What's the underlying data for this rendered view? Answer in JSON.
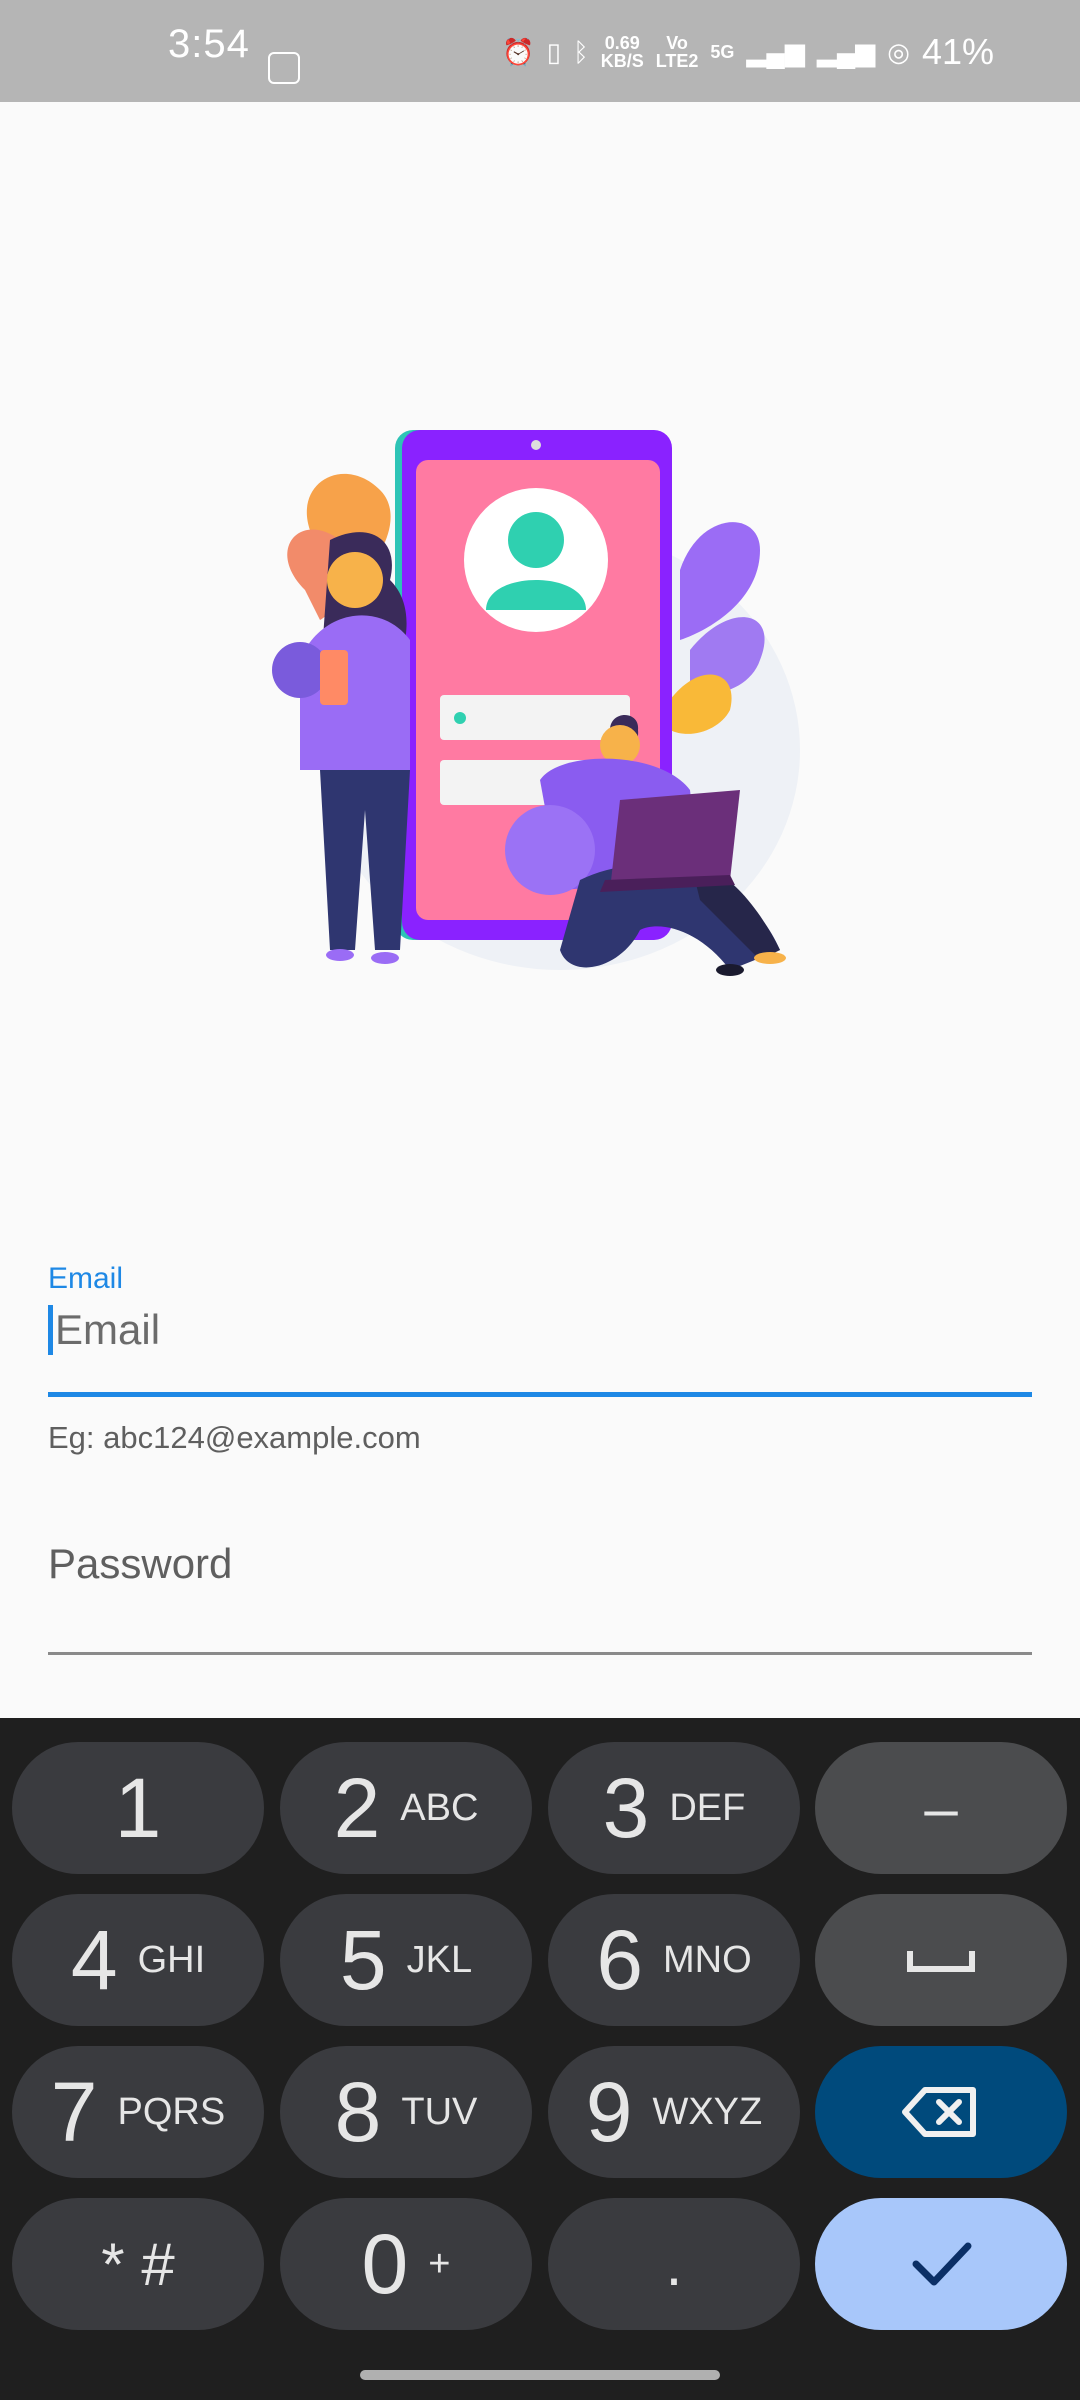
{
  "status_bar": {
    "time": "3:54",
    "net_speed_value": "0.69",
    "net_speed_unit": "KB/S",
    "volte_top": "Vo",
    "volte_bottom": "LTE2",
    "network": "5G",
    "battery": "41%"
  },
  "form": {
    "email_label": "Email",
    "email_placeholder": "Email",
    "email_helper": "Eg: abc124@example.com",
    "password_placeholder": "Password"
  },
  "keyboard": {
    "keys": [
      {
        "num": "1",
        "letters": ""
      },
      {
        "num": "2",
        "letters": "ABC"
      },
      {
        "num": "3",
        "letters": "DEF"
      },
      {
        "num": "4",
        "letters": "GHI"
      },
      {
        "num": "5",
        "letters": "JKL"
      },
      {
        "num": "6",
        "letters": "MNO"
      },
      {
        "num": "7",
        "letters": "PQRS"
      },
      {
        "num": "8",
        "letters": "TUV"
      },
      {
        "num": "9",
        "letters": "WXYZ"
      },
      {
        "num": "* #",
        "letters": ""
      },
      {
        "num": "0",
        "letters": "+"
      },
      {
        "num": ".",
        "letters": ""
      }
    ],
    "minus": "–",
    "space": "␣",
    "backspace_icon": "backspace-icon",
    "done_icon": "check-icon"
  },
  "colors": {
    "accent": "#1e88e5",
    "keyboard_bg": "#1f1f1f",
    "backspace_key": "#004a7c",
    "done_key": "#a8c7fa"
  }
}
